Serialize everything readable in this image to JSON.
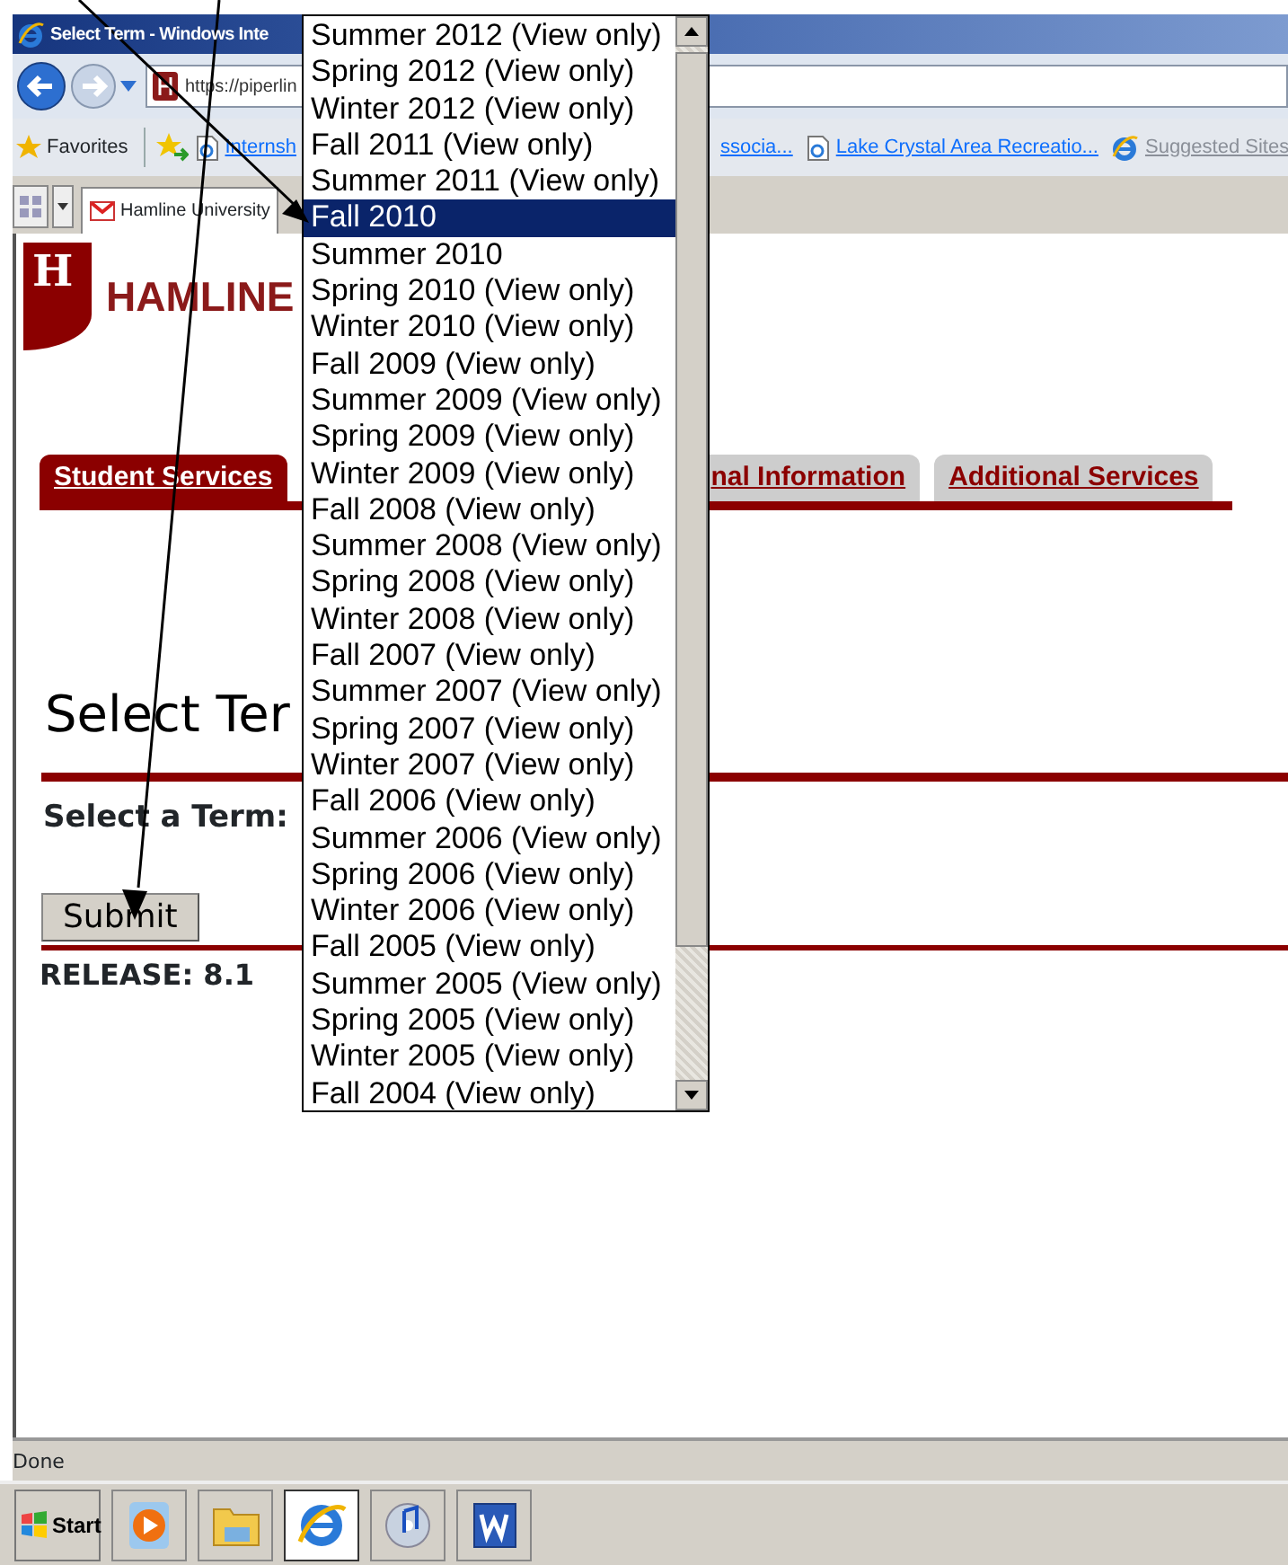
{
  "window": {
    "title": "Select Term - Windows Inte"
  },
  "address_bar": {
    "url": "https://piperlin"
  },
  "favorites_bar": {
    "label": "Favorites",
    "links": [
      {
        "text": "Internsh",
        "kind": "page",
        "disabled": false
      },
      {
        "text": "ssocia...",
        "kind": "plain",
        "disabled": false
      },
      {
        "text": "Lake Crystal Area Recreatio...",
        "kind": "page",
        "disabled": false
      },
      {
        "text": "Suggested Sites",
        "kind": "menu",
        "disabled": true
      }
    ]
  },
  "browser_tabs": [
    {
      "title": "Hamline University",
      "selected": true
    }
  ],
  "page": {
    "logo_letter": "H",
    "logo": "HAMLINE",
    "nav_tabs": [
      {
        "label": "Student Services",
        "selected": true
      },
      {
        "label": "nal Information",
        "selected": false
      },
      {
        "label": "Additional Services",
        "selected": false
      }
    ],
    "heading": "Select Ter",
    "field_label": "Select a Term:",
    "submit": "Submit",
    "release": "RELEASE: 8.1"
  },
  "term_dropdown": {
    "options": [
      {
        "label": "Summer 2012 (View only)",
        "selected": false
      },
      {
        "label": "Spring 2012 (View only)",
        "selected": false
      },
      {
        "label": "Winter 2012 (View only)",
        "selected": false
      },
      {
        "label": "Fall 2011 (View only)",
        "selected": false
      },
      {
        "label": "Summer 2011 (View only)",
        "selected": false
      },
      {
        "label": "Fall 2010",
        "selected": true
      },
      {
        "label": "Summer 2010",
        "selected": false
      },
      {
        "label": "Spring 2010 (View only)",
        "selected": false
      },
      {
        "label": "Winter 2010 (View only)",
        "selected": false
      },
      {
        "label": "Fall 2009 (View only)",
        "selected": false
      },
      {
        "label": "Summer 2009 (View only)",
        "selected": false
      },
      {
        "label": "Spring 2009 (View only)",
        "selected": false
      },
      {
        "label": "Winter 2009 (View only)",
        "selected": false
      },
      {
        "label": "Fall 2008 (View only)",
        "selected": false
      },
      {
        "label": "Summer 2008 (View only)",
        "selected": false
      },
      {
        "label": "Spring 2008 (View only)",
        "selected": false
      },
      {
        "label": "Winter 2008 (View only)",
        "selected": false
      },
      {
        "label": "Fall 2007 (View only)",
        "selected": false
      },
      {
        "label": "Summer 2007 (View only)",
        "selected": false
      },
      {
        "label": "Spring 2007 (View only)",
        "selected": false
      },
      {
        "label": "Winter 2007 (View only)",
        "selected": false
      },
      {
        "label": "Fall 2006 (View only)",
        "selected": false
      },
      {
        "label": "Summer 2006 (View only)",
        "selected": false
      },
      {
        "label": "Spring 2006 (View only)",
        "selected": false
      },
      {
        "label": "Winter 2006 (View only)",
        "selected": false
      },
      {
        "label": "Fall 2005 (View only)",
        "selected": false
      },
      {
        "label": "Summer 2005 (View only)",
        "selected": false
      },
      {
        "label": "Spring 2005 (View only)",
        "selected": false
      },
      {
        "label": "Winter 2005 (View only)",
        "selected": false
      },
      {
        "label": "Fall 2004 (View only)",
        "selected": false
      }
    ]
  },
  "status_bar": {
    "text": "Done"
  },
  "taskbar": {
    "start": "Start",
    "apps": [
      {
        "kind": "media",
        "selected": false
      },
      {
        "kind": "folder",
        "selected": false
      },
      {
        "kind": "browser",
        "selected": true
      },
      {
        "kind": "music",
        "selected": false
      },
      {
        "kind": "word",
        "selected": false
      }
    ]
  }
}
